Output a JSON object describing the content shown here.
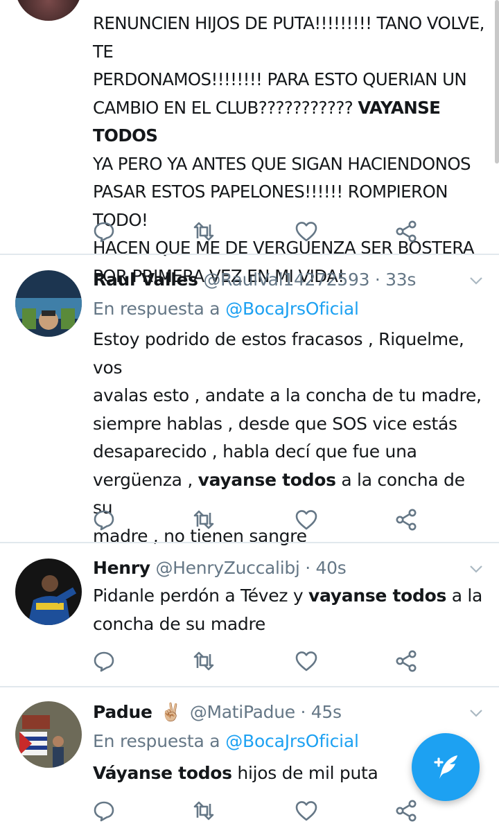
{
  "tweet1": {
    "lines": [
      "RENUNCIEN HIJOS DE PUTA!!!!!!!!! TANO VOLVE, TE",
      "PERDONAMOS!!!!!!!! PARA ESTO QUERIAN UN",
      "CAMBIO EN EL CLUB??????????? ",
      "YA PERO YA ANTES QUE SIGAN HACIENDONOS",
      "PASAR ESTOS PAPELONES!!!!!! ROMPIERON TODO!",
      "HACEN QUE ME DE VERGUENZA SER BOSTERA",
      "POR PRIMERA VEZ EN MI VIDA!"
    ],
    "bold_phrase": "VAYANSE TODOS"
  },
  "tweet2": {
    "name": "Raul Valles",
    "handle": "@RaulVal14272593",
    "separator": "·",
    "time": "33s",
    "reply_prefix": "En respuesta a",
    "reply_mention": "@BocaJrsOficial",
    "lines": [
      "Estoy podrido de estos fracasos , Riquelme, vos",
      "avalas esto , andate a la concha de tu madre,",
      "siempre hablas , desde que SOS vice estás",
      "desaparecido , habla decí que fue una",
      "vergüenza , ",
      " a la concha de su",
      "madre , no tienen sangre"
    ],
    "bold_phrase": "vayanse todos"
  },
  "tweet3": {
    "name": "Henry",
    "handle": "@HenryZuccalibj",
    "separator": "·",
    "time": "40s",
    "lines": [
      "Pidanle perdón a Tévez y ",
      " a la",
      "concha de su madre"
    ],
    "bold_phrase": "vayanse todos"
  },
  "tweet4": {
    "name": "Padue",
    "emoji": "✌🏼",
    "handle": "@MatiPadue",
    "separator": "·",
    "time": "45s",
    "reply_prefix": "En respuesta a",
    "reply_mention": "@BocaJrsOficial",
    "bold_phrase": "Váyanse todos",
    "rest": " hijos de mil puta"
  },
  "icons": {
    "reply": "reply-icon",
    "retweet": "retweet-icon",
    "like": "heart-icon",
    "share": "share-icon",
    "compose": "compose-tweet-icon",
    "more": "chevron-down-icon"
  },
  "colors": {
    "accent": "#1da1f2",
    "muted": "#657786",
    "text": "#14171a",
    "divider": "#e1e8ed"
  }
}
